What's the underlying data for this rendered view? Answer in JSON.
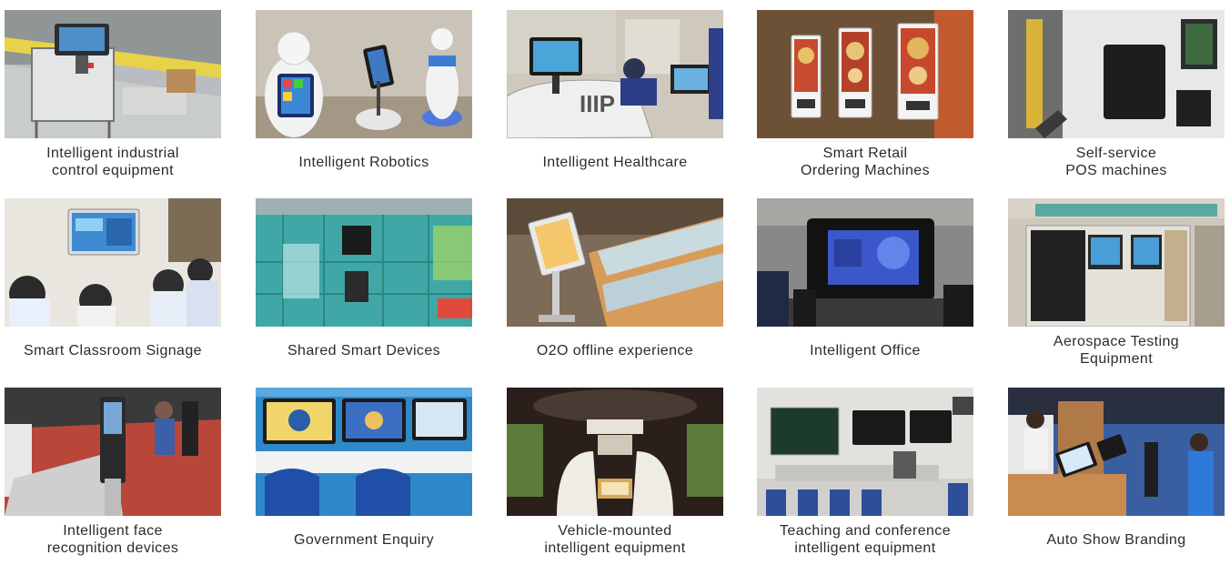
{
  "tiles": [
    {
      "image": "industrial-control-terminal-photo",
      "caption": [
        "Intelligent industrial",
        "control equipment"
      ]
    },
    {
      "image": "service-robots-photo",
      "caption": [
        "Intelligent Robotics"
      ]
    },
    {
      "image": "hospital-kiosk-photo",
      "caption": [
        "Intelligent Healthcare"
      ]
    },
    {
      "image": "ordering-kiosks-photo",
      "caption": [
        "Smart Retail",
        "Ordering Machines"
      ]
    },
    {
      "image": "self-service-pos-photo",
      "caption": [
        "Self-service",
        "POS machines"
      ]
    },
    {
      "image": "classroom-signage-photo",
      "caption": [
        "Smart Classroom Signage"
      ]
    },
    {
      "image": "shared-lockers-photo",
      "caption": [
        "Shared Smart Devices"
      ]
    },
    {
      "image": "store-kiosk-photo",
      "caption": [
        "O2O offline experience"
      ]
    },
    {
      "image": "meeting-room-display-photo",
      "caption": [
        "Intelligent Office"
      ]
    },
    {
      "image": "test-rack-photo",
      "caption": [
        "Aerospace Testing",
        "Equipment"
      ]
    },
    {
      "image": "face-recognition-gate-photo",
      "caption": [
        "Intelligent face",
        "recognition devices"
      ]
    },
    {
      "image": "government-desk-screens-photo",
      "caption": [
        "Government Enquiry"
      ]
    },
    {
      "image": "vehicle-interior-screens-photo",
      "caption": [
        "Vehicle-mounted",
        "intelligent equipment"
      ]
    },
    {
      "image": "conference-room-screens-photo",
      "caption": [
        "Teaching and conference",
        "intelligent equipment"
      ]
    },
    {
      "image": "auto-show-kiosk-photo",
      "caption": [
        "Auto Show Branding"
      ]
    }
  ]
}
